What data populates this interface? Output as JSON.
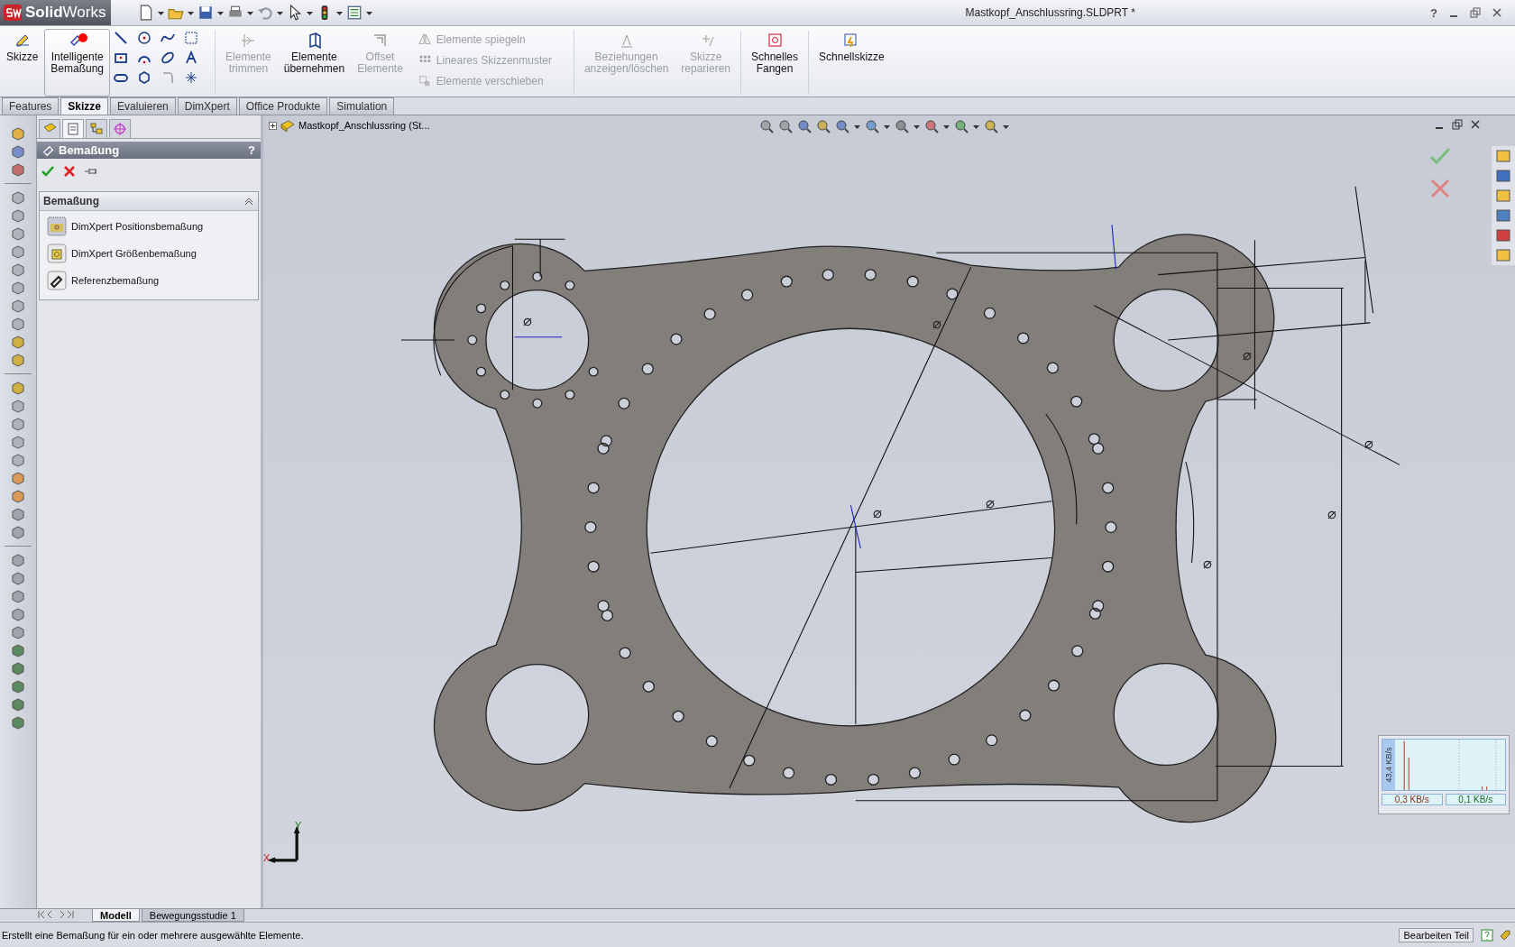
{
  "app": {
    "logo": "**Solid**Works",
    "title": "Mastkopf_Anschlussring.SLDPRT *",
    "help": "?"
  },
  "ribbon": [
    {
      "kind": "big",
      "label": "Skizze",
      "selected": false,
      "disabled": false
    },
    {
      "kind": "big",
      "label": "Intelligente\nBemaßung",
      "selected": true,
      "disabled": false
    },
    {
      "kind": "tools"
    },
    {
      "kind": "big",
      "label": "Elemente\ntrimmen",
      "selected": false,
      "disabled": true
    },
    {
      "kind": "big",
      "label": "Elemente\nübernehmen",
      "selected": false,
      "disabled": false
    },
    {
      "kind": "big",
      "label": "Offset\nElemente",
      "selected": false,
      "disabled": true
    },
    {
      "kind": "stack",
      "items": [
        {
          "label": "Elemente spiegeln",
          "disabled": true
        },
        {
          "label": "Lineares Skizzenmuster",
          "disabled": true
        },
        {
          "label": "Elemente verschieben",
          "disabled": true
        }
      ]
    },
    {
      "kind": "big",
      "label": "Beziehungen\nanzeigen/löschen",
      "selected": false,
      "disabled": true
    },
    {
      "kind": "big",
      "label": "Skizze\nreparieren",
      "selected": false,
      "disabled": true
    },
    {
      "kind": "big",
      "label": "Schnelles\nFangen",
      "selected": false,
      "disabled": false
    },
    {
      "kind": "big",
      "label": "Schnellskizze",
      "selected": false,
      "disabled": false
    }
  ],
  "tabs": [
    {
      "label": "Features",
      "selected": false
    },
    {
      "label": "Skizze",
      "selected": true
    },
    {
      "label": "Evaluieren",
      "selected": false
    },
    {
      "label": "DimXpert",
      "selected": false
    },
    {
      "label": "Office Produkte",
      "selected": false
    },
    {
      "label": "Simulation",
      "selected": false
    }
  ],
  "panel": {
    "tabs": [
      {
        "selected": false
      },
      {
        "selected": true
      },
      {
        "selected": false
      },
      {
        "selected": false
      }
    ],
    "title": "Bemaßung",
    "help": "?",
    "group": {
      "title": "Bemaßung",
      "expanded": true,
      "items": [
        "DimXpert Positionsbemaßung",
        "DimXpert Größenbemaßung",
        "Referenzbemaßung"
      ]
    }
  },
  "tree": {
    "root": "Mastkopf_Anschlussring  (St...",
    "expanded": false
  },
  "viewport": {
    "diameter_marks": [
      "⌀",
      "⌀",
      "⌀",
      "⌀",
      "⌀",
      "⌀",
      "⌀",
      "⌀"
    ],
    "triad": {
      "y": "Y",
      "x": "X"
    }
  },
  "network_monitor": {
    "scale": "43,4 KB/s",
    "down": "0,3 KB/s",
    "up": "0,1 KB/s"
  },
  "bottom_tabs": [
    {
      "label": "Modell",
      "selected": true
    },
    {
      "label": "Bewegungsstudie 1",
      "selected": false
    }
  ],
  "status_bar": {
    "message": "Erstellt eine Bemaßung für ein oder mehrere ausgewählte Elemente.",
    "mode": "Bearbeiten Teil"
  }
}
